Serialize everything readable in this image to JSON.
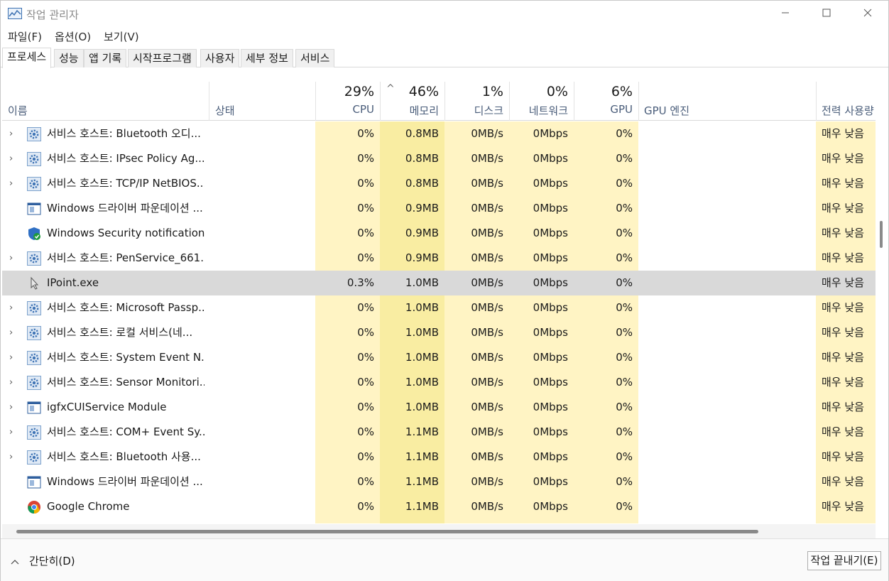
{
  "window": {
    "title": "작업 관리자",
    "controls": {
      "minimize": "—",
      "maximize": "☐",
      "close": "✕"
    }
  },
  "menu": [
    "파일(F)",
    "옵션(O)",
    "보기(V)"
  ],
  "tabs": [
    "프로세스",
    "성능",
    "앱 기록",
    "시작프로그램",
    "사용자",
    "세부 정보",
    "서비스"
  ],
  "active_tab": "프로세스",
  "columns": {
    "name": "이름",
    "status": "상태",
    "cpu": {
      "label": "CPU",
      "percent": "29%"
    },
    "memory": {
      "label": "메모리",
      "percent": "46%"
    },
    "disk": {
      "label": "디스크",
      "percent": "1%"
    },
    "network": {
      "label": "네트워크",
      "percent": "0%"
    },
    "gpu": {
      "label": "GPU",
      "percent": "6%"
    },
    "gpu_engine": "GPU 엔진",
    "power": "전력 사용량",
    "sort_indicator": "^"
  },
  "colors": {
    "heat_light": "#fff4c4",
    "heat_memory": "#f9eda2",
    "selected_row": "#d9d9d9",
    "header_label": "#4a5d7a"
  },
  "rows": [
    {
      "expand": "›",
      "icon": "gear-icon",
      "name": "서비스 호스트: Bluetooth 오디...",
      "cpu": "0%",
      "memory": "0.8MB",
      "disk": "0MB/s",
      "network": "0Mbps",
      "gpu": "0%",
      "power": "매우 낮음"
    },
    {
      "expand": "›",
      "icon": "gear-icon",
      "name": "서비스 호스트: IPsec Policy Ag...",
      "cpu": "0%",
      "memory": "0.8MB",
      "disk": "0MB/s",
      "network": "0Mbps",
      "gpu": "0%",
      "power": "매우 낮음"
    },
    {
      "expand": "›",
      "icon": "gear-icon",
      "name": "서비스 호스트: TCP/IP NetBIOS...",
      "cpu": "0%",
      "memory": "0.8MB",
      "disk": "0MB/s",
      "network": "0Mbps",
      "gpu": "0%",
      "power": "매우 낮음"
    },
    {
      "expand": "",
      "icon": "app-window-icon",
      "name": "Windows 드라이버 파운데이션 ...",
      "cpu": "0%",
      "memory": "0.9MB",
      "disk": "0MB/s",
      "network": "0Mbps",
      "gpu": "0%",
      "power": "매우 낮음"
    },
    {
      "expand": "",
      "icon": "security-shield-icon",
      "name": "Windows Security notification i...",
      "cpu": "0%",
      "memory": "0.9MB",
      "disk": "0MB/s",
      "network": "0Mbps",
      "gpu": "0%",
      "power": "매우 낮음"
    },
    {
      "expand": "›",
      "icon": "gear-icon",
      "name": "서비스 호스트: PenService_661...",
      "cpu": "0%",
      "memory": "0.9MB",
      "disk": "0MB/s",
      "network": "0Mbps",
      "gpu": "0%",
      "power": "매우 낮음"
    },
    {
      "expand": "",
      "icon": "pointer-icon",
      "name": "IPoint.exe",
      "cpu": "0.3%",
      "memory": "1.0MB",
      "disk": "0MB/s",
      "network": "0Mbps",
      "gpu": "0%",
      "power": "매우 낮음",
      "selected": true
    },
    {
      "expand": "›",
      "icon": "gear-icon",
      "name": "서비스 호스트: Microsoft Passp...",
      "cpu": "0%",
      "memory": "1.0MB",
      "disk": "0MB/s",
      "network": "0Mbps",
      "gpu": "0%",
      "power": "매우 낮음"
    },
    {
      "expand": "›",
      "icon": "gear-icon",
      "name": "서비스 호스트: 로컬 서비스(네...",
      "cpu": "0%",
      "memory": "1.0MB",
      "disk": "0MB/s",
      "network": "0Mbps",
      "gpu": "0%",
      "power": "매우 낮음"
    },
    {
      "expand": "›",
      "icon": "gear-icon",
      "name": "서비스 호스트: System Event N...",
      "cpu": "0%",
      "memory": "1.0MB",
      "disk": "0MB/s",
      "network": "0Mbps",
      "gpu": "0%",
      "power": "매우 낮음"
    },
    {
      "expand": "›",
      "icon": "gear-icon",
      "name": "서비스 호스트: Sensor Monitori...",
      "cpu": "0%",
      "memory": "1.0MB",
      "disk": "0MB/s",
      "network": "0Mbps",
      "gpu": "0%",
      "power": "매우 낮음"
    },
    {
      "expand": "›",
      "icon": "app-window-icon",
      "name": "igfxCUIService Module",
      "cpu": "0%",
      "memory": "1.0MB",
      "disk": "0MB/s",
      "network": "0Mbps",
      "gpu": "0%",
      "power": "매우 낮음"
    },
    {
      "expand": "›",
      "icon": "gear-icon",
      "name": "서비스 호스트: COM+ Event Sy...",
      "cpu": "0%",
      "memory": "1.1MB",
      "disk": "0MB/s",
      "network": "0Mbps",
      "gpu": "0%",
      "power": "매우 낮음"
    },
    {
      "expand": "›",
      "icon": "gear-icon",
      "name": "서비스 호스트: Bluetooth 사용...",
      "cpu": "0%",
      "memory": "1.1MB",
      "disk": "0MB/s",
      "network": "0Mbps",
      "gpu": "0%",
      "power": "매우 낮음"
    },
    {
      "expand": "",
      "icon": "app-window-icon",
      "name": "Windows 드라이버 파운데이션 ...",
      "cpu": "0%",
      "memory": "1.1MB",
      "disk": "0MB/s",
      "network": "0Mbps",
      "gpu": "0%",
      "power": "매우 낮음"
    },
    {
      "expand": "",
      "icon": "chrome-icon",
      "name": "Google Chrome",
      "cpu": "0%",
      "memory": "1.1MB",
      "disk": "0MB/s",
      "network": "0Mbps",
      "gpu": "0%",
      "power": "매우 낮음"
    }
  ],
  "footer": {
    "fewer_details": "간단히(D)",
    "end_task": "작업 끝내기(E)"
  }
}
